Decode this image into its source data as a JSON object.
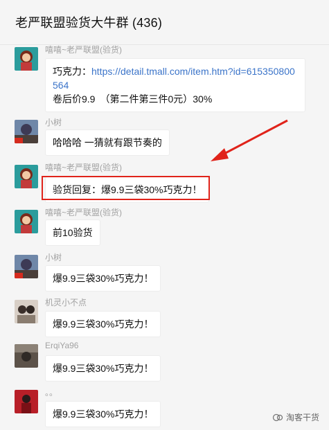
{
  "header": {
    "title": "老严联盟验货大牛群 (436)"
  },
  "messages": [
    {
      "sender": "嘻嘻~老严联盟(验货)",
      "lines": [
        "巧克力：",
        "https://detail.tmall.com/item.htm?id=615350800564",
        "卷后价9.9　（第二件第三件0元）30%"
      ]
    },
    {
      "sender": "小树",
      "text": "哈哈哈 一猜就有跟节奏的"
    },
    {
      "sender": "嘻嘻~老严联盟(验货)",
      "text": "验货回复：爆9.9三袋30%巧克力！"
    },
    {
      "sender": "嘻嘻~老严联盟(验货)",
      "text": "前10验货"
    },
    {
      "sender": "小树",
      "text": "爆9.9三袋30%巧克力！"
    },
    {
      "sender": "机灵小不点",
      "text": "爆9.9三袋30%巧克力！"
    },
    {
      "sender": "ErqiYa96",
      "text": "爆9.9三袋30%巧克力！"
    },
    {
      "sender": "。。",
      "text": "爆9.9三袋30%巧克力！"
    }
  ],
  "watermark": {
    "text": "淘客干货",
    "icon": "wechat-official-account-icon"
  },
  "colors": {
    "link": "#3b74c9",
    "highlight": "#e0231a",
    "arrow": "#e0231a"
  }
}
